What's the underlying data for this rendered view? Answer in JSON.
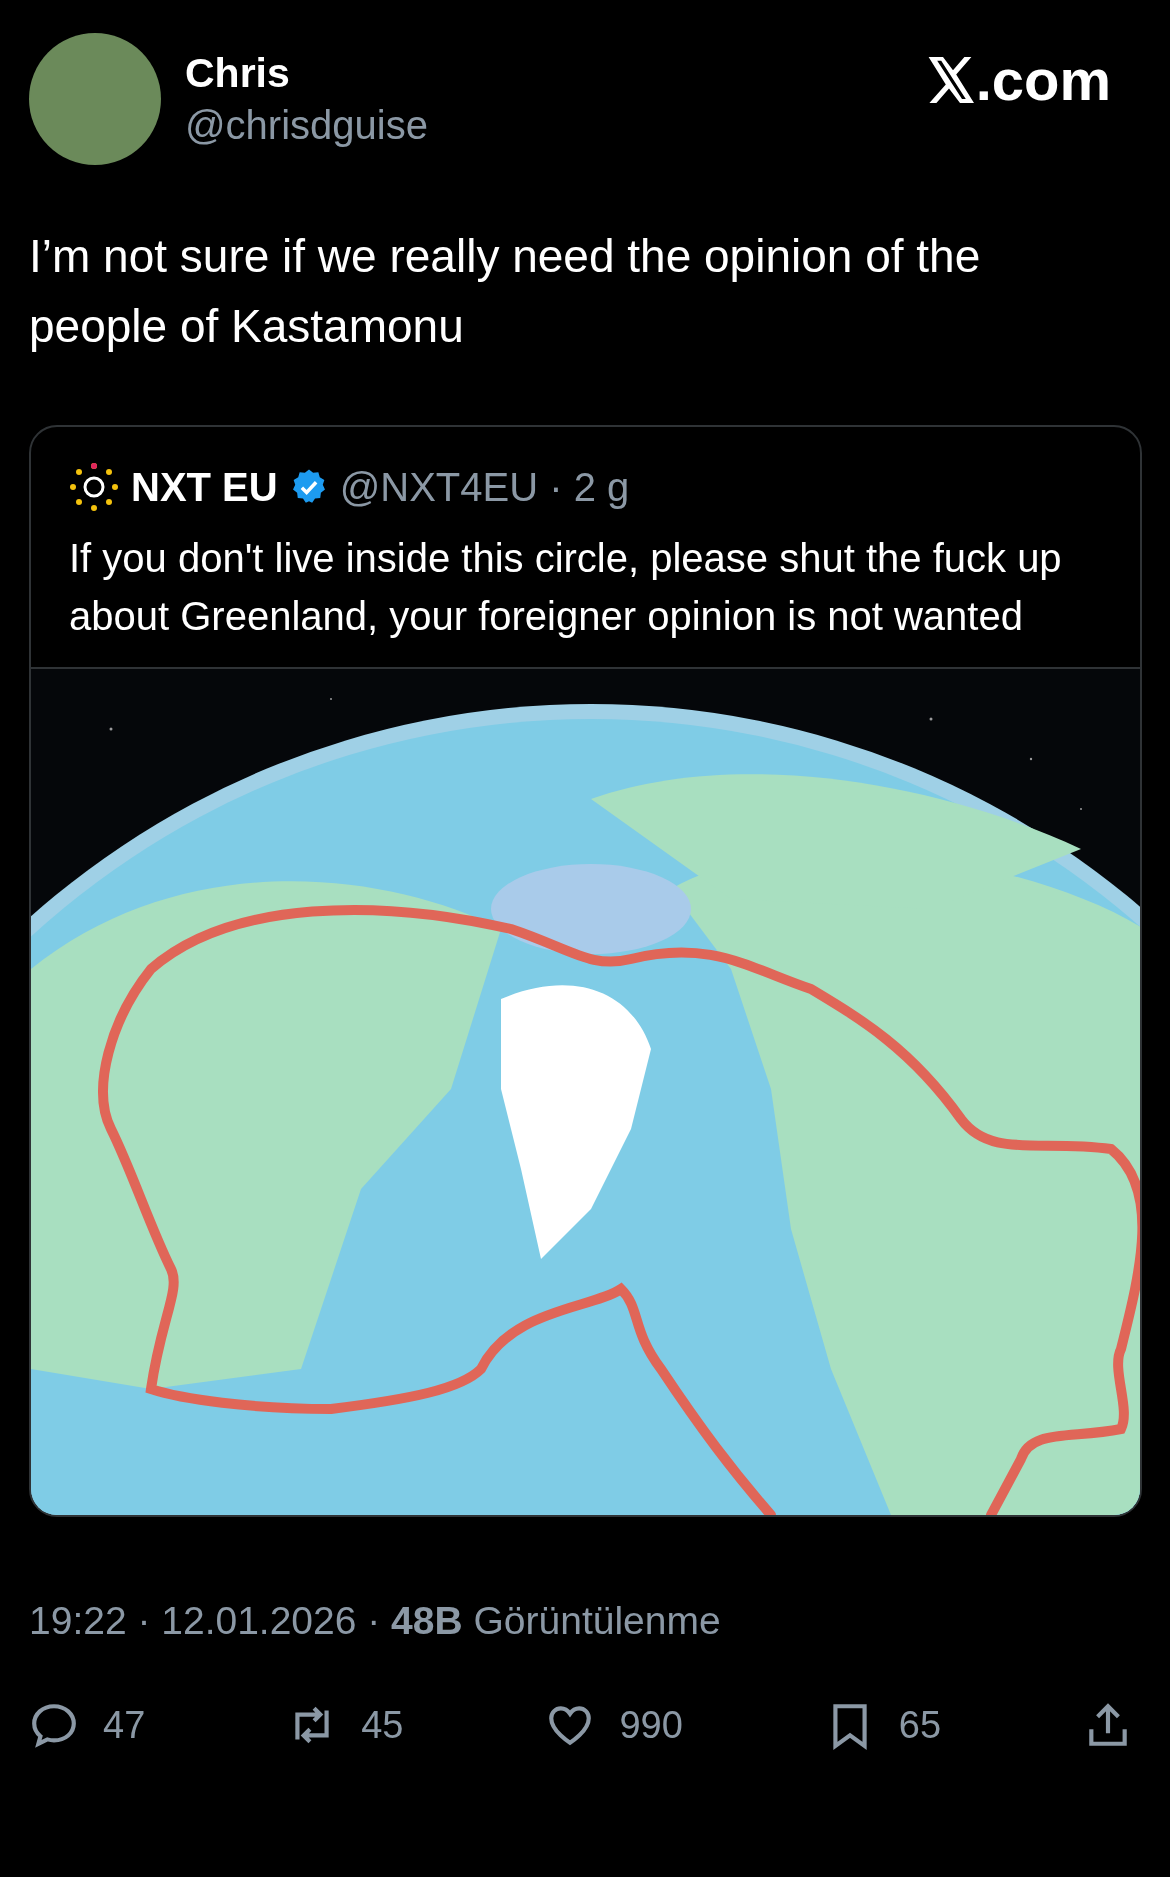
{
  "author": {
    "name": "Chris",
    "handle": "@chrisdguise"
  },
  "brand": ".com",
  "text": "I’m not sure if we really need the opinion of the people of Kastamonu",
  "quote": {
    "name": "NXT EU",
    "verified": true,
    "meta": "@NXT4EU · 2 g",
    "text": "If you don't live inside this circle, please shut the fuck up about Greenland, your foreigner opinion is not wanted"
  },
  "timestamp": "19:22 · 12.01.2026 · **48B** Görüntülenme",
  "actions": [
    {
      "kind": "reply",
      "count": "47"
    },
    {
      "kind": "repost",
      "count": "45"
    },
    {
      "kind": "like",
      "count": "990"
    },
    {
      "kind": "bookmark",
      "count": "65"
    },
    {
      "kind": "share"
    }
  ]
}
